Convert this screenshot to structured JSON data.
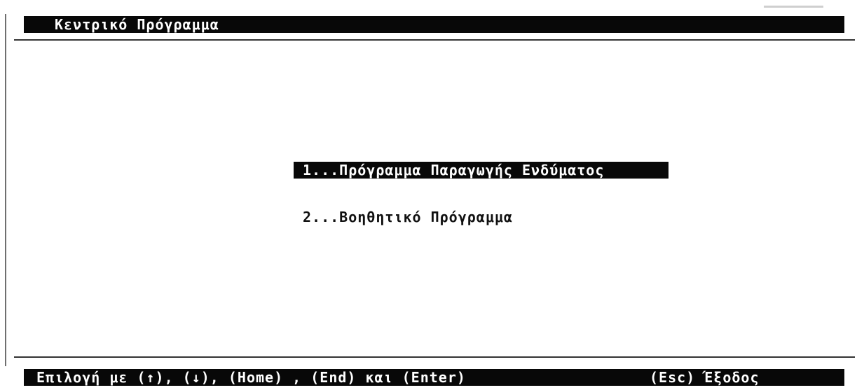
{
  "window": {
    "title": "Κεντρικό Πρόγραμμα"
  },
  "menu": {
    "items": [
      {
        "label": "1...Πρόγραμμα Παραγωγής Ενδύματος",
        "selected": true
      },
      {
        "label": "2...Βοηθητικό Πρόγραμμα",
        "selected": false
      }
    ]
  },
  "status": {
    "help": "Επιλογή με (↑), (↓), (Home) , (End) και (Enter)",
    "exit": "(Esc) Έξοδος"
  },
  "colors": {
    "background": "#ffffff",
    "bar_background": "#080808",
    "bar_text": "#ffffff",
    "text": "#111111"
  }
}
